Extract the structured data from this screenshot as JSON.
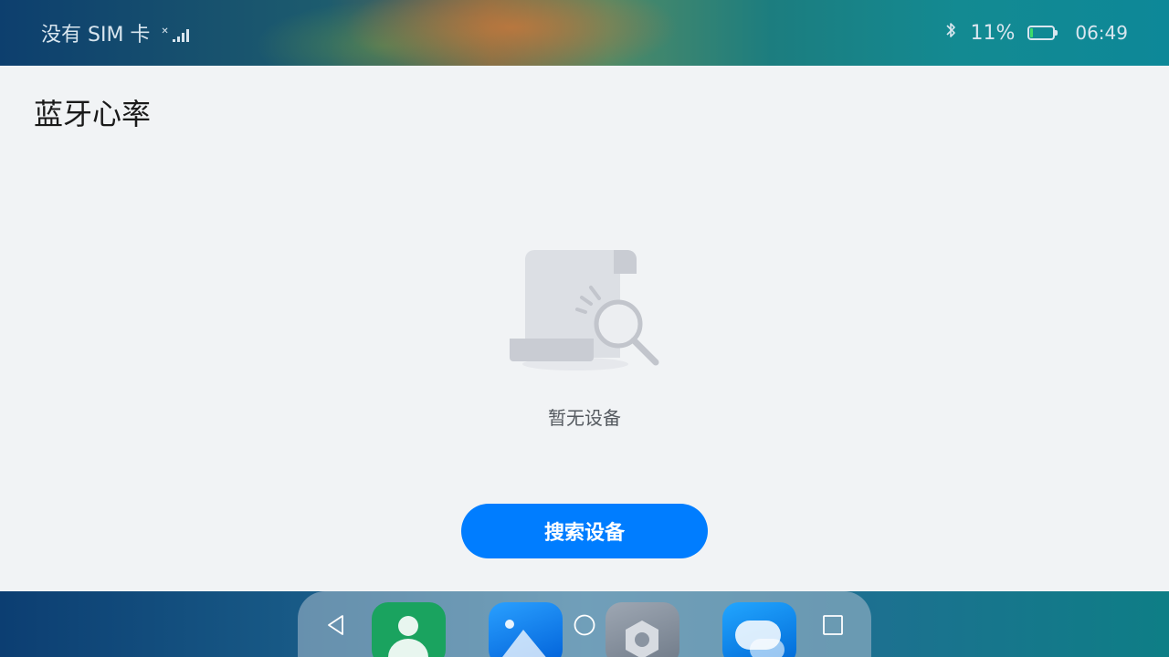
{
  "status_bar": {
    "carrier": "没有 SIM 卡",
    "battery_percent": "11%",
    "battery_level": 0.11,
    "time": "06:49",
    "icons": [
      "signal-icon",
      "bluetooth-icon",
      "battery-icon"
    ]
  },
  "page": {
    "title": "蓝牙心率",
    "empty_message": "暂无设备",
    "search_button": "搜索设备"
  },
  "dock": {
    "apps": [
      "contacts-app-icon",
      "gallery-app-icon",
      "settings-app-icon",
      "messages-app-icon"
    ]
  },
  "navigation": [
    "back-icon",
    "home-icon",
    "recent-apps-icon"
  ],
  "colors": {
    "accent": "#007dff",
    "background": "#f1f3f5",
    "battery_fill": "#3ddc6a"
  }
}
